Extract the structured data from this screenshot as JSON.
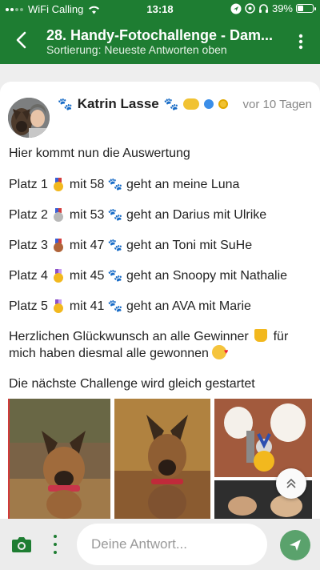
{
  "status_bar": {
    "carrier": "WiFi Calling",
    "time": "13:18",
    "battery_percent": "39%",
    "icons": [
      "signal-icon",
      "wifi-icon",
      "location-icon",
      "do-not-disturb-icon",
      "headphones-icon",
      "battery-icon"
    ]
  },
  "header": {
    "title": "28. Handy-Fotochallenge - Dam...",
    "subtitle": "Sortierung: Neueste Antworten oben",
    "icons": [
      "back-arrow-icon",
      "more-vertical-icon"
    ]
  },
  "post": {
    "author": "Katrin Lasse",
    "time_ago": "vor 10 Tagen",
    "intro": "Hier kommt nun die Auswertung",
    "places": [
      {
        "prefix": "Platz 1",
        "medal": "gold",
        "points": "mit 58",
        "text": "geht an meine Luna"
      },
      {
        "prefix": "Platz 2",
        "medal": "silver",
        "points": "mit 53",
        "text": "geht an Darius mit Ulrike"
      },
      {
        "prefix": "Platz 3",
        "medal": "bronze",
        "points": "mit 47",
        "text": "geht an Toni mit SuHe"
      },
      {
        "prefix": "Platz 4",
        "medal": "gold-purple",
        "points": "mit 45",
        "text": "geht an Snoopy mit Nathalie"
      },
      {
        "prefix": "Platz 5",
        "medal": "gold-purple",
        "points": "mit 41",
        "text": "geht an AVA mit Marie"
      }
    ],
    "congrats_line1": "Herzlichen Glückwunsch an alle Gewinner",
    "congrats_line1_end": "für",
    "congrats_line2": "mich haben diesmal alle gewonnen",
    "next": "Die nächste Challenge wird gleich gestartet"
  },
  "composer": {
    "placeholder": "Deine Antwort..."
  },
  "colors": {
    "brand_green": "#1e7d32",
    "send_green": "#5aa26c"
  }
}
